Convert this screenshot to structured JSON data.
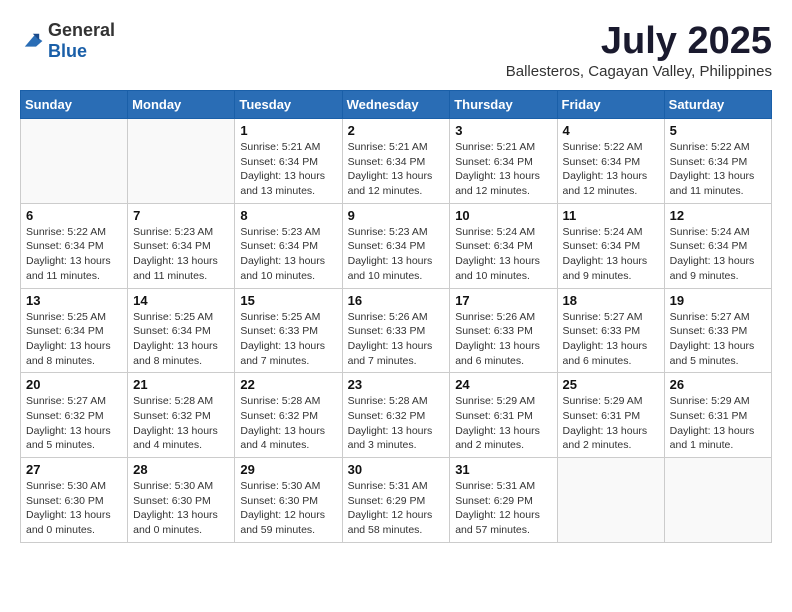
{
  "logo": {
    "general": "General",
    "blue": "Blue"
  },
  "header": {
    "month": "July 2025",
    "location": "Ballesteros, Cagayan Valley, Philippines"
  },
  "weekdays": [
    "Sunday",
    "Monday",
    "Tuesday",
    "Wednesday",
    "Thursday",
    "Friday",
    "Saturday"
  ],
  "weeks": [
    [
      {
        "day": "",
        "info": ""
      },
      {
        "day": "",
        "info": ""
      },
      {
        "day": "1",
        "info": "Sunrise: 5:21 AM\nSunset: 6:34 PM\nDaylight: 13 hours and 13 minutes."
      },
      {
        "day": "2",
        "info": "Sunrise: 5:21 AM\nSunset: 6:34 PM\nDaylight: 13 hours and 12 minutes."
      },
      {
        "day": "3",
        "info": "Sunrise: 5:21 AM\nSunset: 6:34 PM\nDaylight: 13 hours and 12 minutes."
      },
      {
        "day": "4",
        "info": "Sunrise: 5:22 AM\nSunset: 6:34 PM\nDaylight: 13 hours and 12 minutes."
      },
      {
        "day": "5",
        "info": "Sunrise: 5:22 AM\nSunset: 6:34 PM\nDaylight: 13 hours and 11 minutes."
      }
    ],
    [
      {
        "day": "6",
        "info": "Sunrise: 5:22 AM\nSunset: 6:34 PM\nDaylight: 13 hours and 11 minutes."
      },
      {
        "day": "7",
        "info": "Sunrise: 5:23 AM\nSunset: 6:34 PM\nDaylight: 13 hours and 11 minutes."
      },
      {
        "day": "8",
        "info": "Sunrise: 5:23 AM\nSunset: 6:34 PM\nDaylight: 13 hours and 10 minutes."
      },
      {
        "day": "9",
        "info": "Sunrise: 5:23 AM\nSunset: 6:34 PM\nDaylight: 13 hours and 10 minutes."
      },
      {
        "day": "10",
        "info": "Sunrise: 5:24 AM\nSunset: 6:34 PM\nDaylight: 13 hours and 10 minutes."
      },
      {
        "day": "11",
        "info": "Sunrise: 5:24 AM\nSunset: 6:34 PM\nDaylight: 13 hours and 9 minutes."
      },
      {
        "day": "12",
        "info": "Sunrise: 5:24 AM\nSunset: 6:34 PM\nDaylight: 13 hours and 9 minutes."
      }
    ],
    [
      {
        "day": "13",
        "info": "Sunrise: 5:25 AM\nSunset: 6:34 PM\nDaylight: 13 hours and 8 minutes."
      },
      {
        "day": "14",
        "info": "Sunrise: 5:25 AM\nSunset: 6:34 PM\nDaylight: 13 hours and 8 minutes."
      },
      {
        "day": "15",
        "info": "Sunrise: 5:25 AM\nSunset: 6:33 PM\nDaylight: 13 hours and 7 minutes."
      },
      {
        "day": "16",
        "info": "Sunrise: 5:26 AM\nSunset: 6:33 PM\nDaylight: 13 hours and 7 minutes."
      },
      {
        "day": "17",
        "info": "Sunrise: 5:26 AM\nSunset: 6:33 PM\nDaylight: 13 hours and 6 minutes."
      },
      {
        "day": "18",
        "info": "Sunrise: 5:27 AM\nSunset: 6:33 PM\nDaylight: 13 hours and 6 minutes."
      },
      {
        "day": "19",
        "info": "Sunrise: 5:27 AM\nSunset: 6:33 PM\nDaylight: 13 hours and 5 minutes."
      }
    ],
    [
      {
        "day": "20",
        "info": "Sunrise: 5:27 AM\nSunset: 6:32 PM\nDaylight: 13 hours and 5 minutes."
      },
      {
        "day": "21",
        "info": "Sunrise: 5:28 AM\nSunset: 6:32 PM\nDaylight: 13 hours and 4 minutes."
      },
      {
        "day": "22",
        "info": "Sunrise: 5:28 AM\nSunset: 6:32 PM\nDaylight: 13 hours and 4 minutes."
      },
      {
        "day": "23",
        "info": "Sunrise: 5:28 AM\nSunset: 6:32 PM\nDaylight: 13 hours and 3 minutes."
      },
      {
        "day": "24",
        "info": "Sunrise: 5:29 AM\nSunset: 6:31 PM\nDaylight: 13 hours and 2 minutes."
      },
      {
        "day": "25",
        "info": "Sunrise: 5:29 AM\nSunset: 6:31 PM\nDaylight: 13 hours and 2 minutes."
      },
      {
        "day": "26",
        "info": "Sunrise: 5:29 AM\nSunset: 6:31 PM\nDaylight: 13 hours and 1 minute."
      }
    ],
    [
      {
        "day": "27",
        "info": "Sunrise: 5:30 AM\nSunset: 6:30 PM\nDaylight: 13 hours and 0 minutes."
      },
      {
        "day": "28",
        "info": "Sunrise: 5:30 AM\nSunset: 6:30 PM\nDaylight: 13 hours and 0 minutes."
      },
      {
        "day": "29",
        "info": "Sunrise: 5:30 AM\nSunset: 6:30 PM\nDaylight: 12 hours and 59 minutes."
      },
      {
        "day": "30",
        "info": "Sunrise: 5:31 AM\nSunset: 6:29 PM\nDaylight: 12 hours and 58 minutes."
      },
      {
        "day": "31",
        "info": "Sunrise: 5:31 AM\nSunset: 6:29 PM\nDaylight: 12 hours and 57 minutes."
      },
      {
        "day": "",
        "info": ""
      },
      {
        "day": "",
        "info": ""
      }
    ]
  ]
}
